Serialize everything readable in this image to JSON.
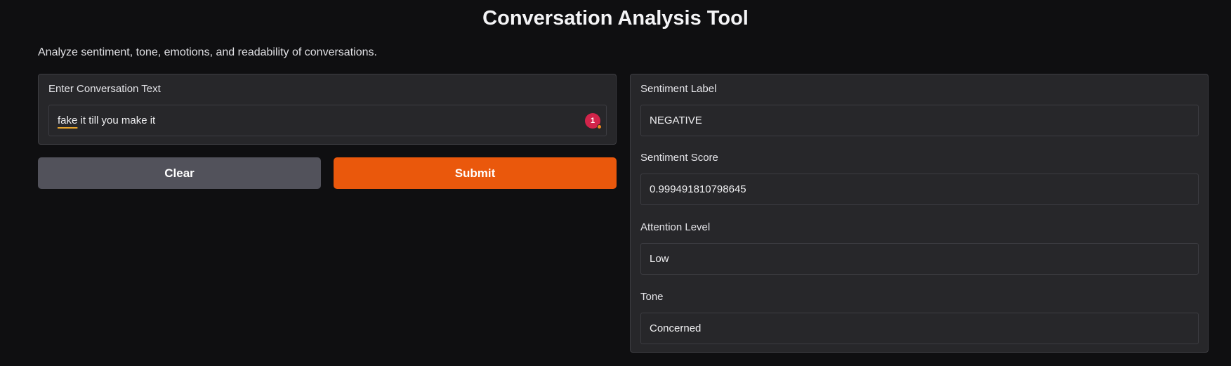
{
  "header": {
    "title": "Conversation Analysis Tool",
    "description": "Analyze sentiment, tone, emotions, and readability of conversations."
  },
  "input_panel": {
    "label": "Enter Conversation Text",
    "value_spellcheck_word": "fake",
    "value_rest": " it till you make it",
    "badge_count": "1"
  },
  "buttons": {
    "clear_label": "Clear",
    "submit_label": "Submit"
  },
  "outputs": [
    {
      "label": "Sentiment Label",
      "value": "NEGATIVE"
    },
    {
      "label": "Sentiment Score",
      "value": "0.999491810798645"
    },
    {
      "label": "Attention Level",
      "value": "Low"
    },
    {
      "label": "Tone",
      "value": "Concerned"
    }
  ],
  "colors": {
    "background": "#0f0f11",
    "panel": "#27272a",
    "submit_accent": "#ea580c",
    "clear_button": "#52525b",
    "badge": "#d1244a"
  }
}
